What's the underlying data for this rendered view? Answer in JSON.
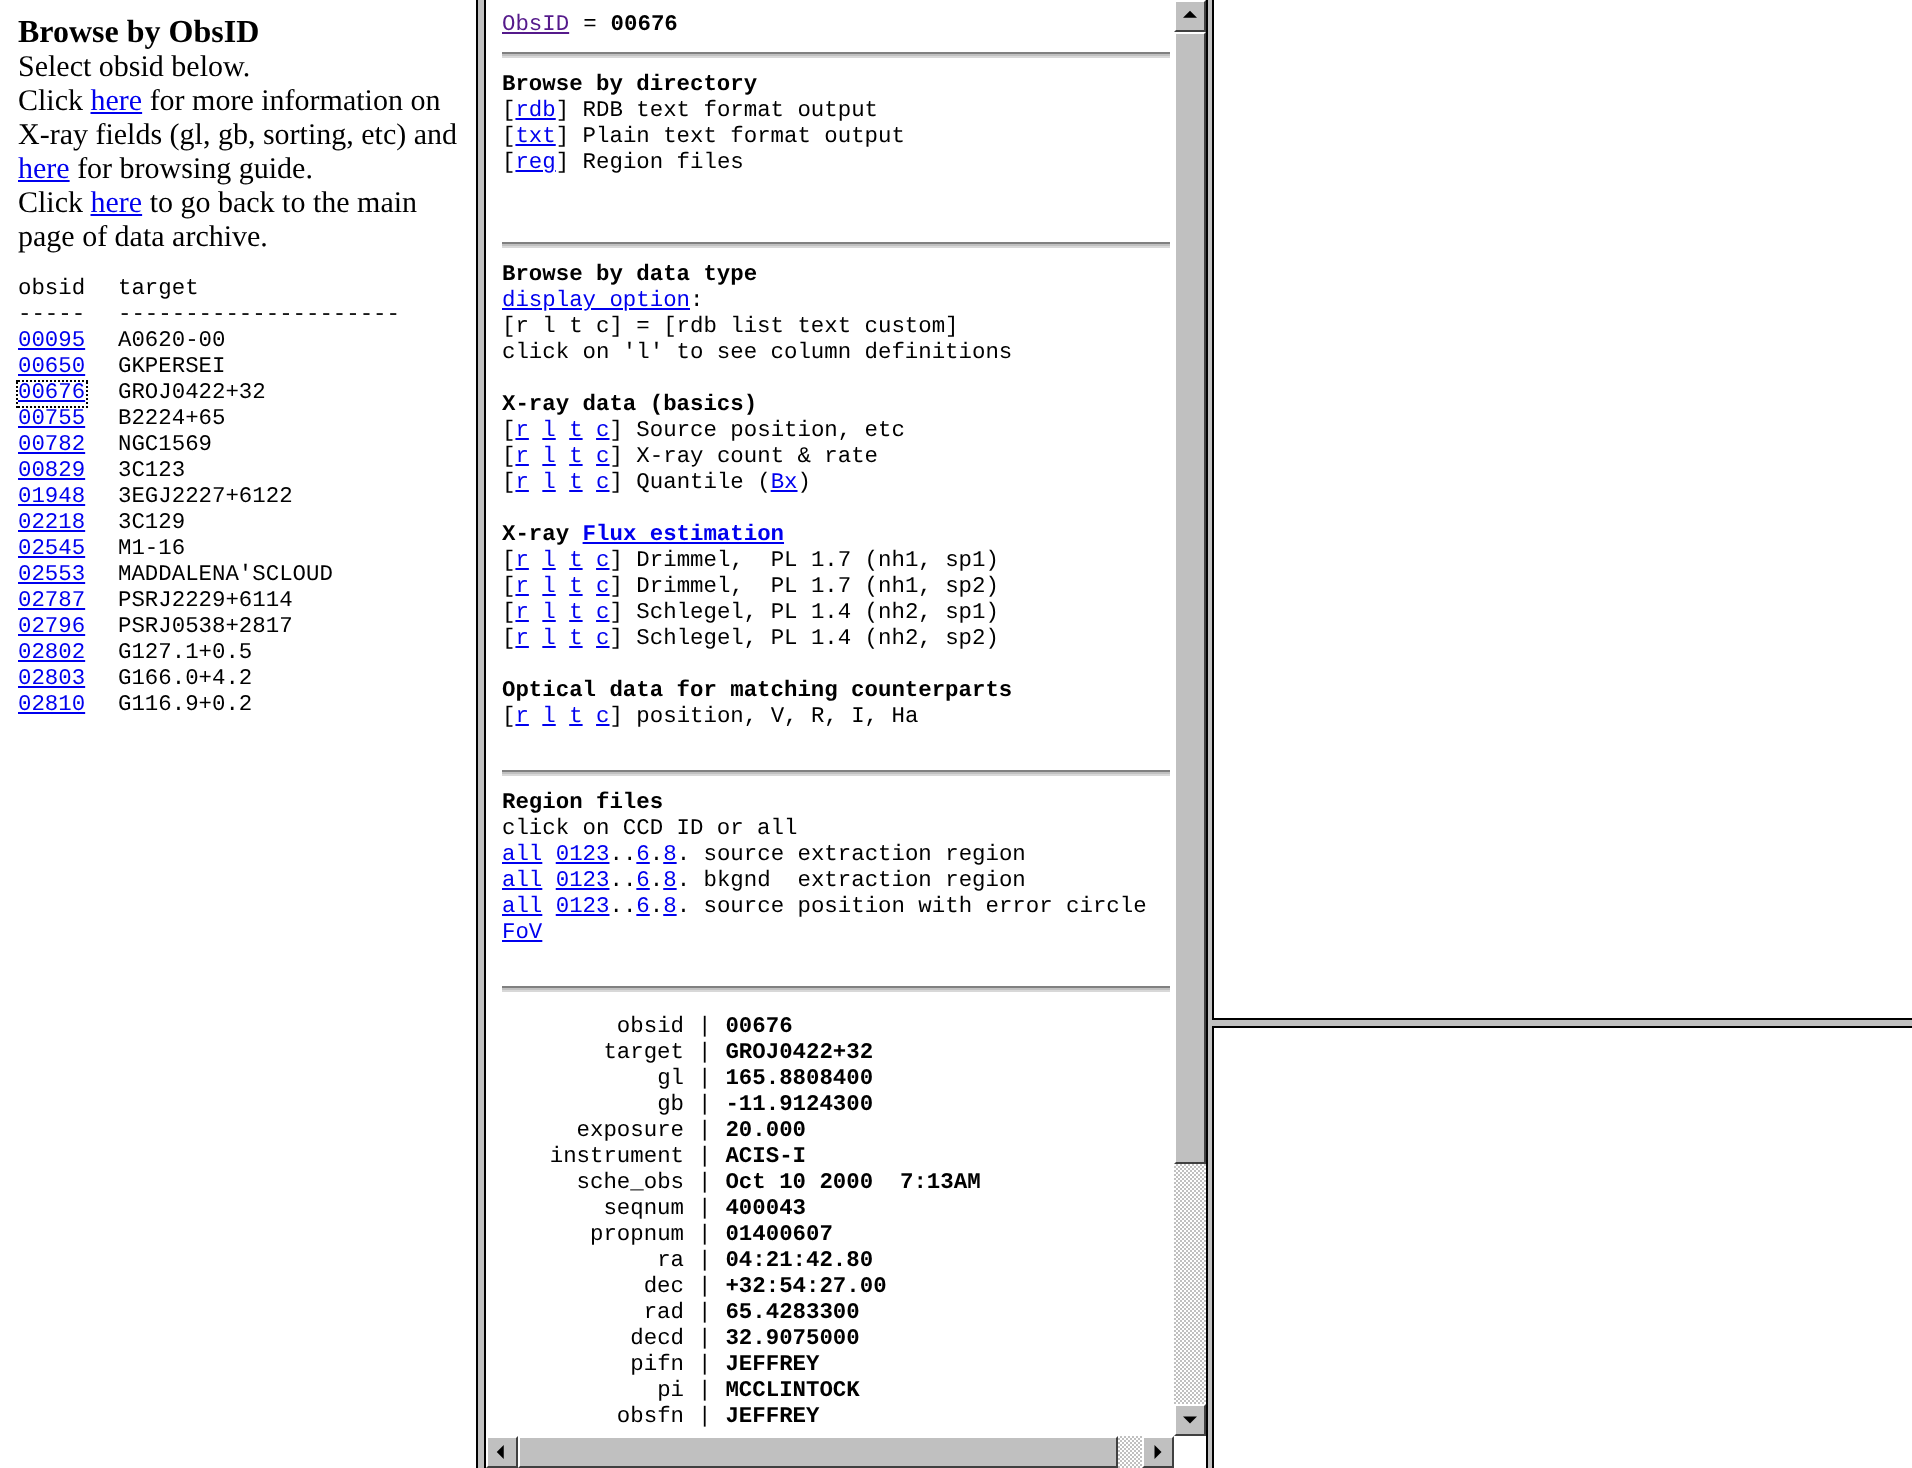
{
  "left": {
    "title": "Browse by ObsID",
    "paragraph": [
      {
        "kind": "text",
        "text": "Select obsid below."
      },
      {
        "kind": "break"
      },
      {
        "kind": "text",
        "text": "Click "
      },
      {
        "kind": "link",
        "text": "here"
      },
      {
        "kind": "text",
        "text": " for more information on X-ray fields (gl, gb, sorting, etc) and "
      },
      {
        "kind": "link",
        "text": "here"
      },
      {
        "kind": "text",
        "text": " for browsing guide."
      },
      {
        "kind": "break"
      },
      {
        "kind": "text",
        "text": "Click "
      },
      {
        "kind": "link",
        "text": "here"
      },
      {
        "kind": "text",
        "text": " to go back to the main page of data archive."
      }
    ],
    "table": {
      "columns": [
        "obsid",
        "target"
      ],
      "dashes": [
        "-----",
        "---------------------"
      ],
      "rows": [
        {
          "obsid": "00095",
          "target": "A0620-00",
          "focused": false
        },
        {
          "obsid": "00650",
          "target": "GKPERSEI",
          "focused": false
        },
        {
          "obsid": "00676",
          "target": "GROJ0422+32",
          "focused": true
        },
        {
          "obsid": "00755",
          "target": "B2224+65",
          "focused": false
        },
        {
          "obsid": "00782",
          "target": "NGC1569",
          "focused": false
        },
        {
          "obsid": "00829",
          "target": "3C123",
          "focused": false
        },
        {
          "obsid": "01948",
          "target": "3EGJ2227+6122",
          "focused": false
        },
        {
          "obsid": "02218",
          "target": "3C129",
          "focused": false
        },
        {
          "obsid": "02545",
          "target": "M1-16",
          "focused": false
        },
        {
          "obsid": "02553",
          "target": "MADDALENA'SCLOUD",
          "focused": false
        },
        {
          "obsid": "02787",
          "target": "PSRJ2229+6114",
          "focused": false
        },
        {
          "obsid": "02796",
          "target": "PSRJ0538+2817",
          "focused": false
        },
        {
          "obsid": "02802",
          "target": "G127.1+0.5",
          "focused": false
        },
        {
          "obsid": "02803",
          "target": "G166.0+4.2",
          "focused": false
        },
        {
          "obsid": "02810",
          "target": "G116.9+0.2",
          "focused": false
        }
      ]
    }
  },
  "middle": {
    "header": {
      "link": "ObsID",
      "link_visited": true,
      "equals": "=",
      "value": "00676"
    },
    "sections": [
      {
        "rule_before": true,
        "heading": [
          {
            "kind": "text",
            "text": "Browse by directory"
          }
        ],
        "lines": [
          [
            {
              "kind": "text",
              "text": "["
            },
            {
              "kind": "link",
              "text": "rdb"
            },
            {
              "kind": "text",
              "text": "] RDB text format output"
            }
          ],
          [
            {
              "kind": "text",
              "text": "["
            },
            {
              "kind": "link",
              "text": "txt"
            },
            {
              "kind": "text",
              "text": "] Plain text format output"
            }
          ],
          [
            {
              "kind": "text",
              "text": "["
            },
            {
              "kind": "link",
              "text": "reg"
            },
            {
              "kind": "text",
              "text": "] Region files"
            }
          ]
        ]
      },
      {
        "rule_before": true,
        "heading": [
          {
            "kind": "text",
            "text": "Browse by data type"
          }
        ],
        "lines": [
          [
            {
              "kind": "link",
              "text": "display option"
            },
            {
              "kind": "text",
              "text": ":"
            }
          ],
          [
            {
              "kind": "text",
              "text": "[r l t c] = [rdb list text custom]"
            }
          ],
          [
            {
              "kind": "text",
              "text": "click on 'l' to see column definitions"
            }
          ]
        ]
      },
      {
        "rule_before": false,
        "heading": [
          {
            "kind": "text",
            "text": "X-ray data (basics)"
          }
        ],
        "lines": [
          [
            {
              "kind": "text",
              "text": "["
            },
            {
              "kind": "link",
              "text": "r"
            },
            {
              "kind": "space"
            },
            {
              "kind": "link",
              "text": "l"
            },
            {
              "kind": "space"
            },
            {
              "kind": "link",
              "text": "t"
            },
            {
              "kind": "space"
            },
            {
              "kind": "link",
              "text": "c"
            },
            {
              "kind": "text",
              "text": "] Source position, etc"
            }
          ],
          [
            {
              "kind": "text",
              "text": "["
            },
            {
              "kind": "link",
              "text": "r"
            },
            {
              "kind": "space"
            },
            {
              "kind": "link",
              "text": "l"
            },
            {
              "kind": "space"
            },
            {
              "kind": "link",
              "text": "t"
            },
            {
              "kind": "space"
            },
            {
              "kind": "link",
              "text": "c"
            },
            {
              "kind": "text",
              "text": "] X-ray count & rate"
            }
          ],
          [
            {
              "kind": "text",
              "text": "["
            },
            {
              "kind": "link",
              "text": "r"
            },
            {
              "kind": "space"
            },
            {
              "kind": "link",
              "text": "l"
            },
            {
              "kind": "space"
            },
            {
              "kind": "link",
              "text": "t"
            },
            {
              "kind": "space"
            },
            {
              "kind": "link",
              "text": "c"
            },
            {
              "kind": "text",
              "text": "] Quantile ("
            },
            {
              "kind": "link",
              "text": "Bx"
            },
            {
              "kind": "text",
              "text": ")"
            }
          ]
        ]
      },
      {
        "rule_before": false,
        "heading": [
          {
            "kind": "text",
            "text": "X-ray "
          },
          {
            "kind": "link",
            "text": "Flux estimation"
          }
        ],
        "lines": [
          [
            {
              "kind": "text",
              "text": "["
            },
            {
              "kind": "link",
              "text": "r"
            },
            {
              "kind": "space"
            },
            {
              "kind": "link",
              "text": "l"
            },
            {
              "kind": "space"
            },
            {
              "kind": "link",
              "text": "t"
            },
            {
              "kind": "space"
            },
            {
              "kind": "link",
              "text": "c"
            },
            {
              "kind": "text",
              "text": "] Drimmel,  PL 1.7 (nh1, sp1)"
            }
          ],
          [
            {
              "kind": "text",
              "text": "["
            },
            {
              "kind": "link",
              "text": "r"
            },
            {
              "kind": "space"
            },
            {
              "kind": "link",
              "text": "l"
            },
            {
              "kind": "space"
            },
            {
              "kind": "link",
              "text": "t"
            },
            {
              "kind": "space"
            },
            {
              "kind": "link",
              "text": "c"
            },
            {
              "kind": "text",
              "text": "] Drimmel,  PL 1.7 (nh1, sp2)"
            }
          ],
          [
            {
              "kind": "text",
              "text": "["
            },
            {
              "kind": "link",
              "text": "r"
            },
            {
              "kind": "space"
            },
            {
              "kind": "link",
              "text": "l"
            },
            {
              "kind": "space"
            },
            {
              "kind": "link",
              "text": "t"
            },
            {
              "kind": "space"
            },
            {
              "kind": "link",
              "text": "c"
            },
            {
              "kind": "text",
              "text": "] Schlegel, PL 1.4 (nh2, sp1)"
            }
          ],
          [
            {
              "kind": "text",
              "text": "["
            },
            {
              "kind": "link",
              "text": "r"
            },
            {
              "kind": "space"
            },
            {
              "kind": "link",
              "text": "l"
            },
            {
              "kind": "space"
            },
            {
              "kind": "link",
              "text": "t"
            },
            {
              "kind": "space"
            },
            {
              "kind": "link",
              "text": "c"
            },
            {
              "kind": "text",
              "text": "] Schlegel, PL 1.4 (nh2, sp2)"
            }
          ]
        ]
      },
      {
        "rule_before": false,
        "heading": [
          {
            "kind": "text",
            "text": "Optical data for matching counterparts"
          }
        ],
        "lines": [
          [
            {
              "kind": "text",
              "text": "["
            },
            {
              "kind": "link",
              "text": "r"
            },
            {
              "kind": "space"
            },
            {
              "kind": "link",
              "text": "l"
            },
            {
              "kind": "space"
            },
            {
              "kind": "link",
              "text": "t"
            },
            {
              "kind": "space"
            },
            {
              "kind": "link",
              "text": "c"
            },
            {
              "kind": "text",
              "text": "] position, V, R, I, Ha"
            }
          ]
        ]
      },
      {
        "rule_before": true,
        "heading": [
          {
            "kind": "text",
            "text": "Region files"
          }
        ],
        "lines": [
          [
            {
              "kind": "text",
              "text": "click on CCD ID or all"
            }
          ],
          [
            {
              "kind": "link",
              "text": "all"
            },
            {
              "kind": "space"
            },
            {
              "kind": "link",
              "text": "0123"
            },
            {
              "kind": "text",
              "text": ".."
            },
            {
              "kind": "link",
              "text": "6"
            },
            {
              "kind": "text",
              "text": "."
            },
            {
              "kind": "link",
              "text": "8"
            },
            {
              "kind": "text",
              "text": ". source extraction region"
            }
          ],
          [
            {
              "kind": "link",
              "text": "all"
            },
            {
              "kind": "space"
            },
            {
              "kind": "link",
              "text": "0123"
            },
            {
              "kind": "text",
              "text": ".."
            },
            {
              "kind": "link",
              "text": "6"
            },
            {
              "kind": "text",
              "text": "."
            },
            {
              "kind": "link",
              "text": "8"
            },
            {
              "kind": "text",
              "text": ". bkgnd  extraction region"
            }
          ],
          [
            {
              "kind": "link",
              "text": "all"
            },
            {
              "kind": "space"
            },
            {
              "kind": "link",
              "text": "0123"
            },
            {
              "kind": "text",
              "text": ".."
            },
            {
              "kind": "link",
              "text": "6"
            },
            {
              "kind": "text",
              "text": "."
            },
            {
              "kind": "link",
              "text": "8"
            },
            {
              "kind": "text",
              "text": ". source position with error circle"
            }
          ],
          [
            {
              "kind": "link",
              "text": "FoV"
            }
          ]
        ]
      }
    ],
    "details": [
      {
        "field": "obsid",
        "value": "00676"
      },
      {
        "field": "target",
        "value": "GROJ0422+32"
      },
      {
        "field": "gl",
        "value": "165.8808400"
      },
      {
        "field": "gb",
        "value": "-11.9124300"
      },
      {
        "field": "exposure",
        "value": "20.000"
      },
      {
        "field": "instrument",
        "value": "ACIS-I"
      },
      {
        "field": "sche_obs",
        "value": "Oct 10 2000  7:13AM"
      },
      {
        "field": "seqnum",
        "value": "400043"
      },
      {
        "field": "propnum",
        "value": "01400607"
      },
      {
        "field": "ra",
        "value": "04:21:42.80"
      },
      {
        "field": "dec",
        "value": "+32:54:27.00"
      },
      {
        "field": "rad",
        "value": "65.4283300"
      },
      {
        "field": "decd",
        "value": "32.9075000"
      },
      {
        "field": "pifn",
        "value": "JEFFREY"
      },
      {
        "field": "pi",
        "value": "MCCLINTOCK"
      },
      {
        "field": "obsfn",
        "value": "JEFFREY"
      }
    ],
    "separator": "|"
  }
}
